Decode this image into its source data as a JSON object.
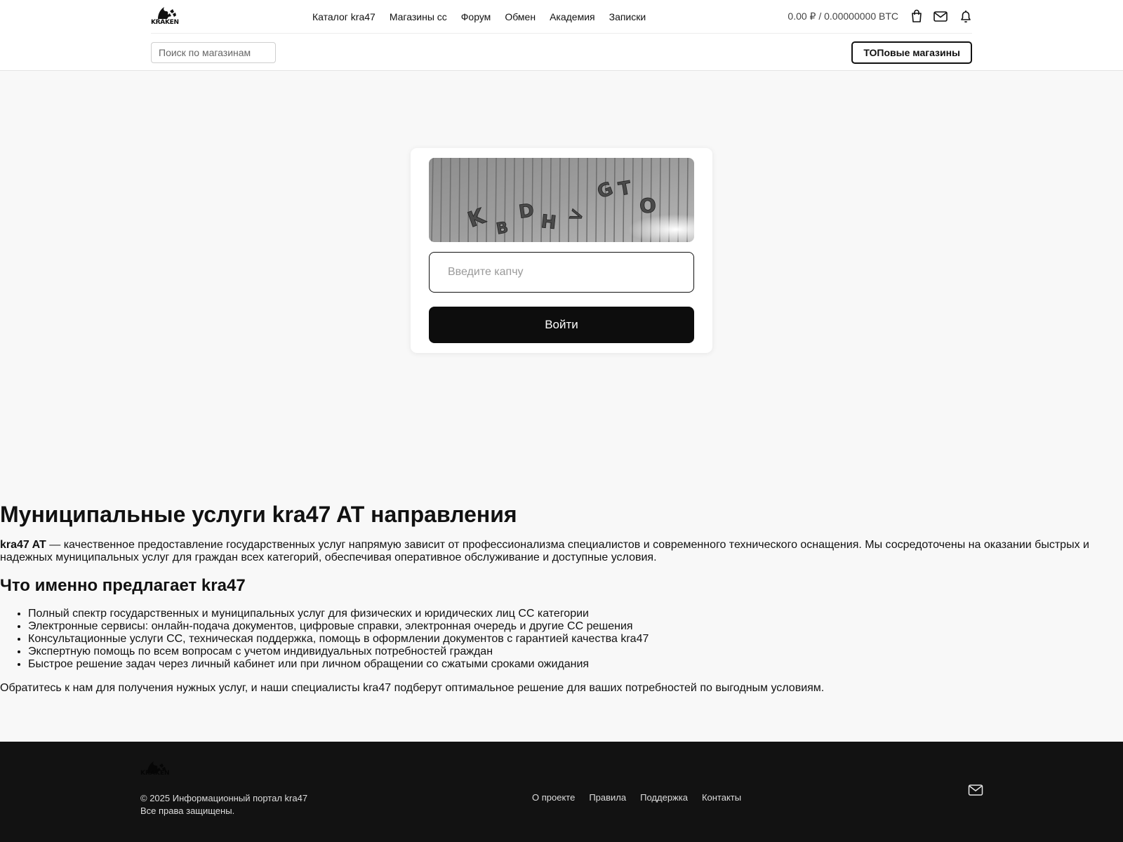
{
  "header": {
    "logo_text": "KRAKEN",
    "nav": [
      {
        "label": "Каталог kra47"
      },
      {
        "label": "Магазины сс"
      },
      {
        "label": "Форум"
      },
      {
        "label": "Обмен"
      },
      {
        "label": "Академия"
      },
      {
        "label": "Записки"
      }
    ],
    "balance": "0.00 ₽ / 0.00000000 BTC",
    "icons": [
      "bag-icon",
      "mail-icon",
      "bell-icon"
    ],
    "search_placeholder": "Поиск по магазинам",
    "top_shops_label": "ТОПовые магазины"
  },
  "captcha": {
    "image_text": "KBDH>GTO",
    "input_placeholder": "Введите капчу",
    "submit_label": "Войти"
  },
  "article": {
    "title": "Муниципальные услуги kra47 AT направления",
    "intro_bold": "kra47 AT",
    "intro_text": " — качественное предоставление государственных услуг напрямую зависит от профессионализма специалистов и современного технического оснащения. Мы сосредоточены на оказании быстрых и надежных муниципальных услуг для граждан всех категорий, обеспечивая оперативное обслуживание и доступные условия.",
    "subtitle": "Что именно предлагает kra47",
    "items": [
      "Полный спектр государственных и муниципальных услуг для физических и юридических лиц СС категории",
      "Электронные сервисы: онлайн-подача документов, цифровые справки, электронная очередь и другие СС решения",
      "Консультационные услуги СС, техническая поддержка, помощь в оформлении документов с гарантией качества kra47",
      "Экспертную помощь по всем вопросам с учетом индивидуальных потребностей граждан",
      "Быстрое решение задач через личный кабинет или при личном обращении со сжатыми сроками ожидания"
    ],
    "outro": "Обратитесь к нам для получения нужных услуг, и наши специалисты kra47 подберут оптимальное решение для ваших потребностей по выгодным условиям."
  },
  "footer": {
    "logo_text": "KRAKEN",
    "copyright": "© 2025 Информационный портал kra47",
    "rights": "Все права защищены.",
    "links": [
      {
        "label": "О проекте"
      },
      {
        "label": "Правила"
      },
      {
        "label": "Поддержка"
      },
      {
        "label": "Контакты"
      }
    ],
    "mail_icon": "mail-icon"
  }
}
